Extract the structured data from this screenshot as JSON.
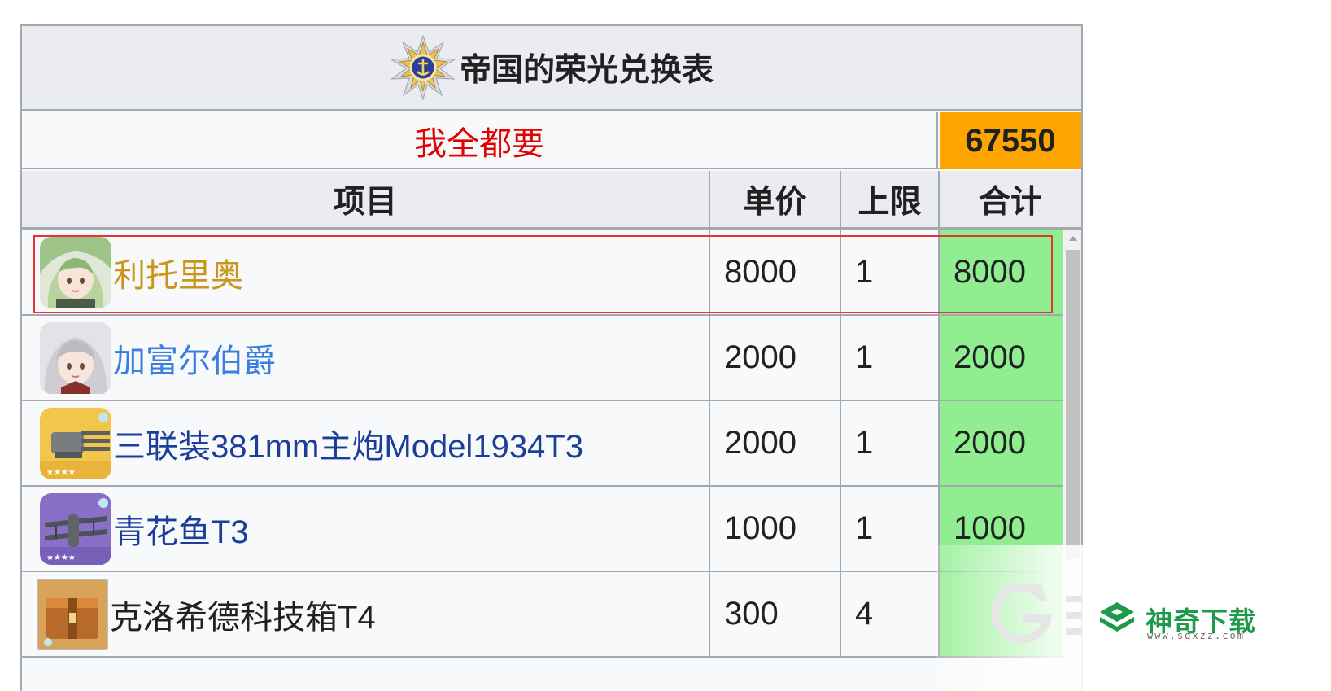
{
  "table": {
    "title": "帝国的荣光兑换表",
    "summary_label": "我全都要",
    "summary_total": "67550",
    "headers": [
      "项目",
      "单价",
      "上限",
      "合计"
    ],
    "rows": [
      {
        "name": "利托里奥",
        "price": "8000",
        "limit": "1",
        "total": "8000",
        "link_color": "gold"
      },
      {
        "name": "加富尔伯爵",
        "price": "2000",
        "limit": "1",
        "total": "2000",
        "link_color": "blue"
      },
      {
        "name": "三联装381mm主炮Model1934T3",
        "price": "2000",
        "limit": "1",
        "total": "2000",
        "link_color": "navy"
      },
      {
        "name": "青花鱼T3",
        "price": "1000",
        "limit": "1",
        "total": "1000",
        "link_color": "navy"
      },
      {
        "name": "克洛希德科技箱T4",
        "price": "300",
        "limit": "4",
        "total": "",
        "link_color": "none"
      }
    ]
  },
  "watermark": {
    "brand": "神奇下载",
    "url": "www.sqxzz.com"
  },
  "colors": {
    "header_bg": "#eaecf0",
    "border": "#a2a9b1",
    "summary_total_bg": "#ffa500",
    "total_cell_bg": "#90ee90",
    "summary_label_red": "#e20000",
    "highlight_box": "#e8323a",
    "watermark_green": "#1f9a4b"
  }
}
